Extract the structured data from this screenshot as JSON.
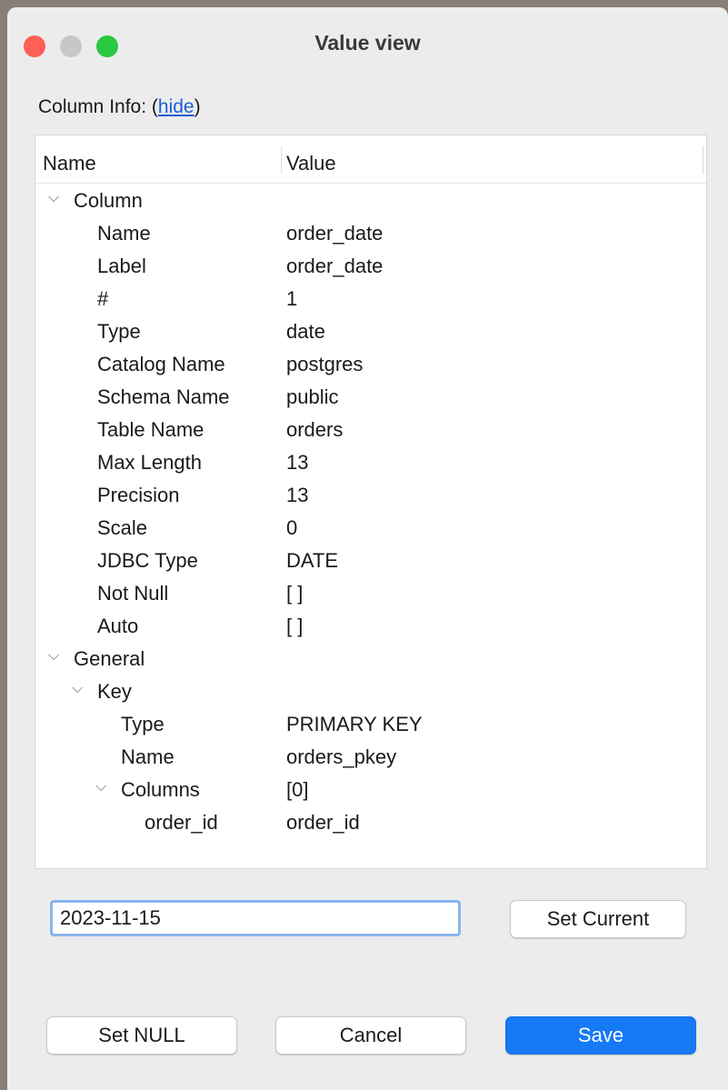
{
  "window": {
    "title": "Value view"
  },
  "column_info": {
    "label": "Column Info: (",
    "link": "hide",
    "suffix": ")"
  },
  "tree": {
    "headers": {
      "name": "Name",
      "value": "Value"
    },
    "rows": [
      {
        "name": "Column",
        "value": "",
        "expanded": true
      },
      {
        "name": "Name",
        "value": "order_date"
      },
      {
        "name": "Label",
        "value": "order_date"
      },
      {
        "name": "#",
        "value": "1"
      },
      {
        "name": "Type",
        "value": "date"
      },
      {
        "name": "Catalog Name",
        "value": "postgres"
      },
      {
        "name": "Schema Name",
        "value": "public"
      },
      {
        "name": "Table Name",
        "value": "orders"
      },
      {
        "name": "Max Length",
        "value": "13"
      },
      {
        "name": "Precision",
        "value": "13"
      },
      {
        "name": "Scale",
        "value": "0"
      },
      {
        "name": "JDBC Type",
        "value": "DATE"
      },
      {
        "name": "Not Null",
        "value": "[ ]"
      },
      {
        "name": "Auto",
        "value": "[ ]"
      },
      {
        "name": "General",
        "value": "",
        "expanded": true
      },
      {
        "name": "Key",
        "value": "",
        "expanded": true
      },
      {
        "name": "Type",
        "value": "PRIMARY KEY"
      },
      {
        "name": "Name",
        "value": "orders_pkey"
      },
      {
        "name": "Columns",
        "value": "[0]",
        "expanded": true
      },
      {
        "name": "order_id",
        "value": "order_id"
      }
    ]
  },
  "editor": {
    "value": "2023-11-15"
  },
  "buttons": {
    "set_current": "Set Current",
    "set_null": "Set NULL",
    "cancel": "Cancel",
    "save": "Save"
  }
}
